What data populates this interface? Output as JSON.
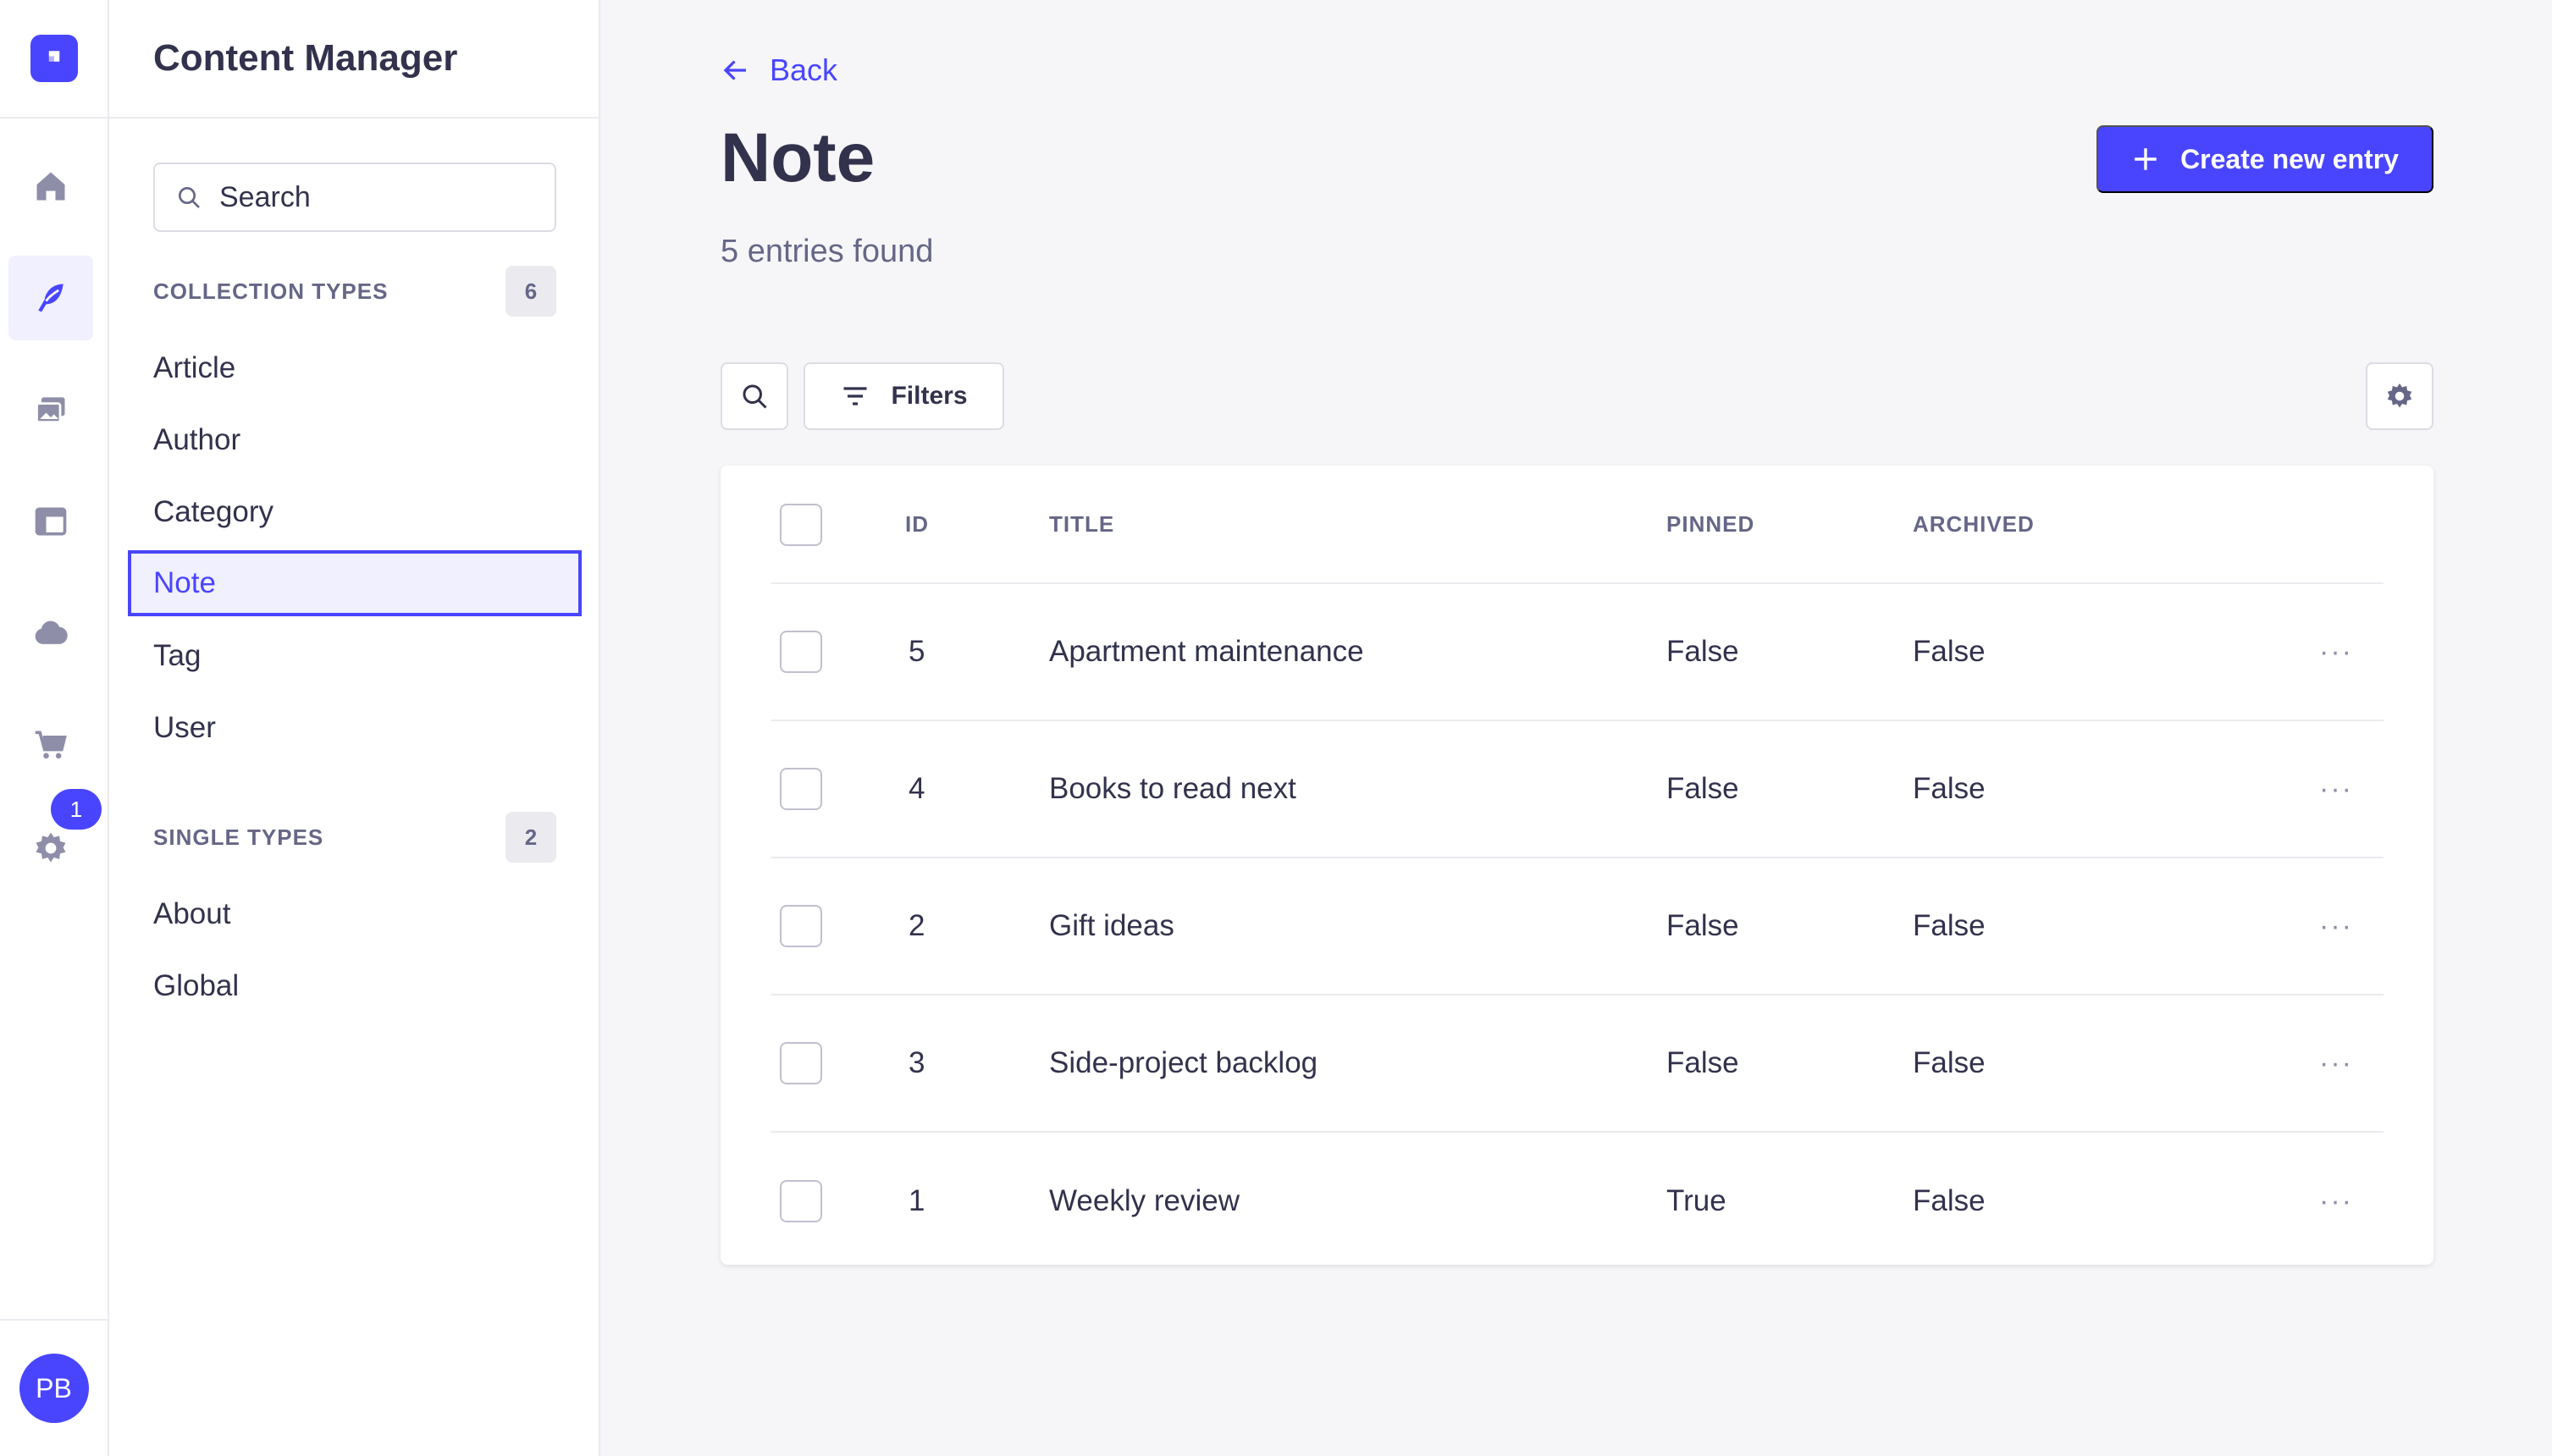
{
  "app": {
    "avatar_initials": "PB",
    "settings_badge": "1",
    "accent": "#4945ff"
  },
  "rail": {
    "icons": [
      "logo-icon",
      "home-icon",
      "content-manager-icon",
      "media-library-icon",
      "layout-icon",
      "cloud-icon",
      "cart-icon",
      "settings-icon"
    ]
  },
  "subnav": {
    "title": "Content Manager",
    "search_placeholder": "Search",
    "collection_label": "COLLECTION TYPES",
    "collection_count": "6",
    "collection_items": [
      "Article",
      "Author",
      "Category",
      "Note",
      "Tag",
      "User"
    ],
    "active_item": "Note",
    "single_label": "SINGLE TYPES",
    "single_count": "2",
    "single_items": [
      "About",
      "Global"
    ]
  },
  "main": {
    "back_label": "Back",
    "title": "Note",
    "subtitle": "5 entries found",
    "create_label": "Create new entry",
    "filters_label": "Filters"
  },
  "table": {
    "headers": {
      "id": "ID",
      "title": "TITLE",
      "pinned": "PINNED",
      "archived": "ARCHIVED"
    },
    "rows": [
      {
        "id": "5",
        "title": "Apartment maintenance",
        "pinned": "False",
        "archived": "False"
      },
      {
        "id": "4",
        "title": "Books to read next",
        "pinned": "False",
        "archived": "False"
      },
      {
        "id": "2",
        "title": "Gift ideas",
        "pinned": "False",
        "archived": "False"
      },
      {
        "id": "3",
        "title": "Side-project backlog",
        "pinned": "False",
        "archived": "False"
      },
      {
        "id": "1",
        "title": "Weekly review",
        "pinned": "True",
        "archived": "False"
      }
    ],
    "more_glyph": "···"
  }
}
